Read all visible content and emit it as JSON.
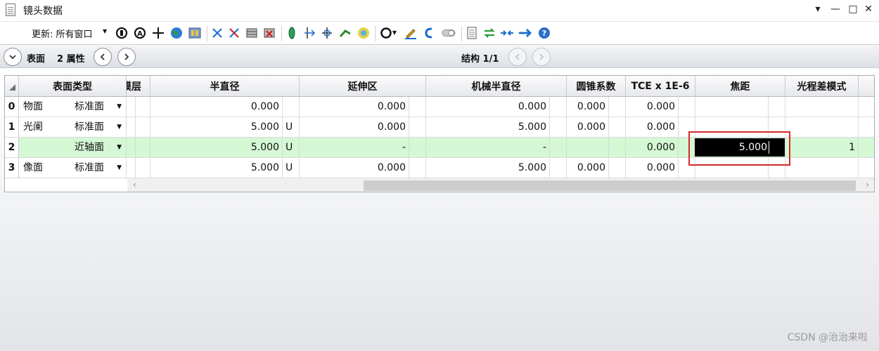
{
  "window": {
    "title": "镜头数据",
    "controls": [
      "▾",
      "—",
      "□",
      "✕"
    ]
  },
  "toolbar": {
    "update_label": "更新: 所有窗口"
  },
  "nav": {
    "surface_label": "表面",
    "properties_label": "2 属性",
    "config_label": "结构 1/1"
  },
  "table": {
    "headers": [
      "表面类型",
      "膜层",
      "半直径",
      "延伸区",
      "机械半直径",
      "圆锥系数",
      "TCE x 1E-6",
      "焦距",
      "光程差模式"
    ],
    "rows": [
      {
        "index": "0",
        "name": "物面",
        "type": "标准面",
        "semi_dia": "0.000",
        "semi_flag": "",
        "ext": "0.000",
        "mech": "0.000",
        "conic": "0.000",
        "tce": "0.000",
        "focal": "",
        "opd": ""
      },
      {
        "index": "1",
        "name": "光阑",
        "type": "标准面",
        "semi_dia": "5.000",
        "semi_flag": "U",
        "ext": "0.000",
        "mech": "5.000",
        "conic": "0.000",
        "tce": "0.000",
        "focal": "",
        "opd": ""
      },
      {
        "index": "2",
        "name": "",
        "type": "近轴面",
        "semi_dia": "5.000",
        "semi_flag": "U",
        "ext": "-",
        "mech": "-",
        "conic": "",
        "tce": "0.000",
        "focal": "5.000",
        "opd": "1"
      },
      {
        "index": "3",
        "name": "像面",
        "type": "标准面",
        "semi_dia": "5.000",
        "semi_flag": "U",
        "ext": "0.000",
        "mech": "5.000",
        "conic": "0.000",
        "tce": "0.000",
        "focal": "",
        "opd": ""
      }
    ]
  },
  "watermark": "CSDN @治治来啦",
  "colors": {
    "selected_row": "#d4f7d4",
    "edit_box": "#000000",
    "highlight_frame": "#d42a2a"
  }
}
